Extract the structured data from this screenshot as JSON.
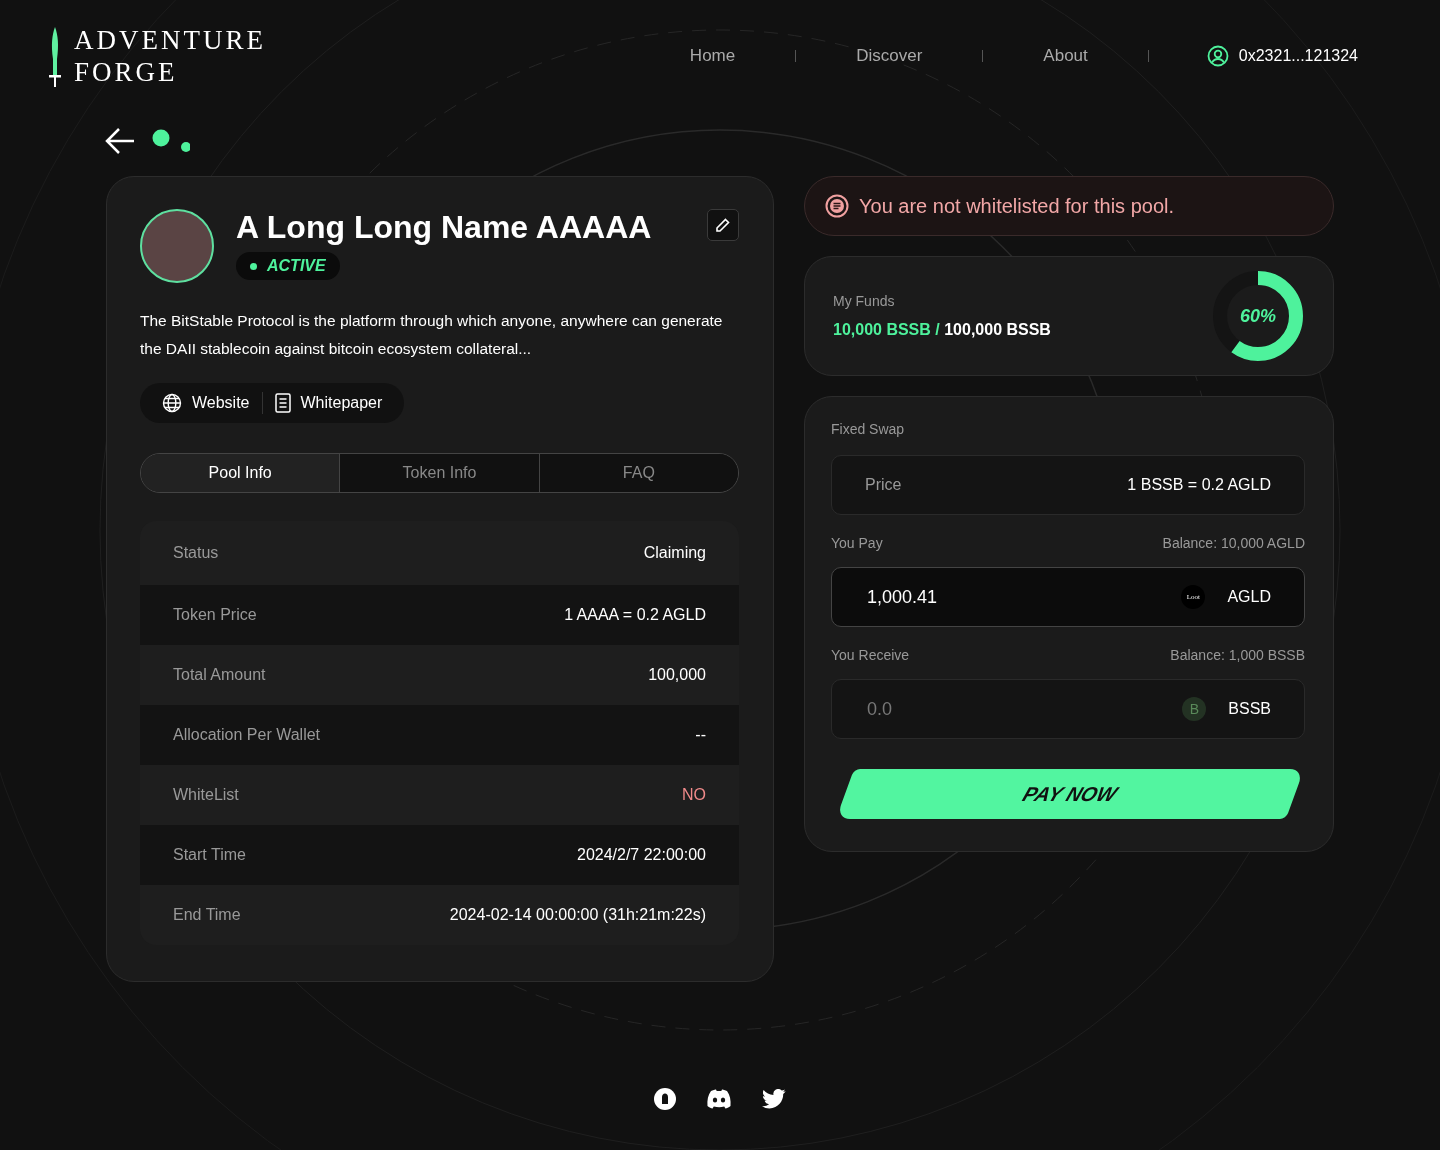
{
  "header": {
    "logo": [
      "ADVENTURE",
      "FORGE"
    ],
    "nav": [
      {
        "label": "Home"
      },
      {
        "label": "Discover"
      },
      {
        "label": "About"
      }
    ],
    "wallet": "0x2321...121324"
  },
  "pool": {
    "name": "A Long Long Name AAAAA",
    "status": "ACTIVE",
    "description": "The BitStable Protocol is the platform through which anyone, anywhere can generate the DAII stablecoin against bitcoin ecosystem collateral...",
    "links": [
      {
        "kind": "globe",
        "label": "Website"
      },
      {
        "kind": "document",
        "label": "Whitepaper"
      }
    ],
    "tabs": [
      {
        "label": "Pool Info",
        "selected": true
      },
      {
        "label": "Token Info",
        "selected": false
      },
      {
        "label": "FAQ",
        "selected": false
      }
    ],
    "rows": [
      {
        "label": "Status",
        "value": "Claiming",
        "warning": false
      },
      {
        "label": "Token Price",
        "value": "1 AAAA = 0.2 AGLD",
        "warning": false
      },
      {
        "label": "Total Amount",
        "value": "100,000",
        "warning": false
      },
      {
        "label": "Allocation Per Wallet",
        "value": "--",
        "warning": false
      },
      {
        "label": "WhiteList",
        "value": "NO",
        "warning": true
      },
      {
        "label": "Start Time",
        "value": "2024/2/7 22:00:00",
        "warning": false
      },
      {
        "label": "End Time",
        "value": "2024-02-14 00:00:00 (31h:21m:22s)",
        "warning": false
      }
    ]
  },
  "notice": "You are not whitelisted for this pool.",
  "funds": {
    "label": "My Funds",
    "amount": "10,000 BSSB /",
    "total": "100,000 BSSB",
    "level": 0.6,
    "percent": "60%"
  },
  "swap": {
    "title": "Fixed Swap",
    "price_label": "Price",
    "price": "1 BSSB = 0.2 AGLD",
    "pay": {
      "label": "You Pay",
      "balance": "Balance: 10,000 AGLD",
      "value": "1,000.41",
      "token_badge": "Loot",
      "token": "AGLD"
    },
    "receive": {
      "label": "You Receive",
      "balance": "Balance: 1,000 BSSB",
      "placeholder": "0.0",
      "token_badge": "B",
      "token": "BSSB"
    },
    "button": "PAY NOW"
  },
  "footer": {
    "socials": [
      {
        "kind": "opensea"
      },
      {
        "kind": "discord"
      },
      {
        "kind": "twitter"
      }
    ]
  }
}
